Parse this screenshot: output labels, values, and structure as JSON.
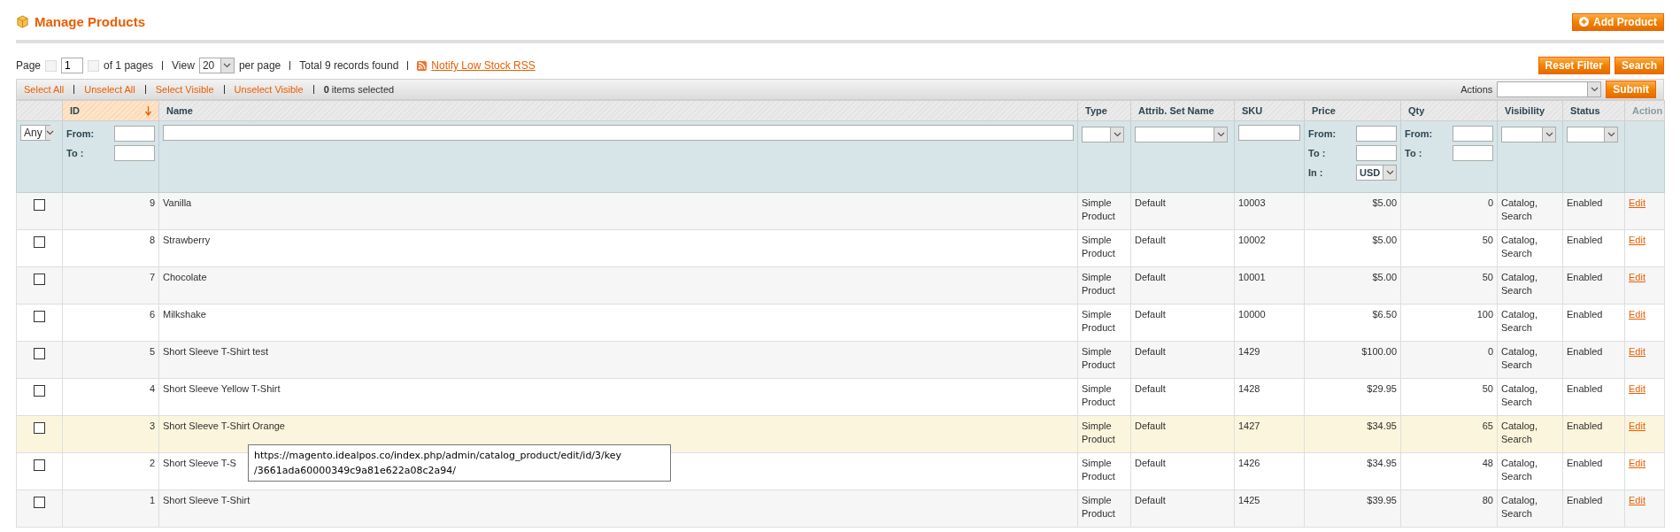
{
  "header": {
    "title": "Manage Products",
    "add_button": "Add Product"
  },
  "pager": {
    "page_label": "Page",
    "page_value": "1",
    "of_pages": "of 1 pages",
    "view_label": "View",
    "view_value": "20",
    "per_page": "per page",
    "total": "Total 9 records found",
    "rss_link": "Notify Low Stock RSS"
  },
  "filter_buttons": [
    "Reset Filter",
    "Search"
  ],
  "massaction": {
    "links": [
      "Select All",
      "Unselect All",
      "Select Visible",
      "Unselect Visible"
    ],
    "count": "0",
    "count_suffix": "items selected",
    "actions_label": "Actions",
    "submit": "Submit"
  },
  "columns": [
    {
      "kind": "checkbox",
      "sorted": false,
      "filter": {
        "kind": "select",
        "value": "Any"
      }
    },
    {
      "kind": "sortable",
      "label": "ID",
      "sorted": true,
      "filter": {
        "kind": "range",
        "from_label": "From:",
        "to_label": "To :"
      }
    },
    {
      "kind": "sortable",
      "label": "Name",
      "sorted": false,
      "filter": {
        "kind": "text"
      }
    },
    {
      "kind": "sortable",
      "label": "Type",
      "sorted": false,
      "filter": {
        "kind": "select"
      }
    },
    {
      "kind": "sortable",
      "label": "Attrib. Set Name",
      "sorted": false,
      "filter": {
        "kind": "select"
      }
    },
    {
      "kind": "sortable",
      "label": "SKU",
      "sorted": false,
      "filter": {
        "kind": "text"
      }
    },
    {
      "kind": "sortable",
      "label": "Price",
      "sorted": false,
      "filter": {
        "kind": "range",
        "from_label": "From:",
        "to_label": "To :",
        "currency_label": "In :",
        "currency_value": "USD"
      }
    },
    {
      "kind": "sortable",
      "label": "Qty",
      "sorted": false,
      "filter": {
        "kind": "range",
        "from_label": "From:",
        "to_label": "To :"
      }
    },
    {
      "kind": "sortable",
      "label": "Visibility",
      "sorted": false,
      "filter": {
        "kind": "select"
      }
    },
    {
      "kind": "sortable",
      "label": "Status",
      "sorted": false,
      "filter": {
        "kind": "select"
      }
    },
    {
      "kind": "static",
      "label": "Action",
      "sorted": false,
      "filter": {
        "kind": "none"
      }
    }
  ],
  "rows": [
    {
      "checked": false,
      "highlighted": false,
      "id": "9",
      "name": "Vanilla",
      "type": "Simple Product",
      "attribute_set": "Default",
      "sku": "10003",
      "price": "$5.00",
      "qty": "0",
      "visibility": "Catalog, Search",
      "status": "Enabled",
      "action": "Edit"
    },
    {
      "checked": false,
      "highlighted": false,
      "id": "8",
      "name": "Strawberry",
      "type": "Simple Product",
      "attribute_set": "Default",
      "sku": "10002",
      "price": "$5.00",
      "qty": "50",
      "visibility": "Catalog, Search",
      "status": "Enabled",
      "action": "Edit"
    },
    {
      "checked": false,
      "highlighted": false,
      "id": "7",
      "name": "Chocolate",
      "type": "Simple Product",
      "attribute_set": "Default",
      "sku": "10001",
      "price": "$5.00",
      "qty": "50",
      "visibility": "Catalog, Search",
      "status": "Enabled",
      "action": "Edit"
    },
    {
      "checked": false,
      "highlighted": false,
      "id": "6",
      "name": "Milkshake",
      "type": "Simple Product",
      "attribute_set": "Default",
      "sku": "10000",
      "price": "$6.50",
      "qty": "100",
      "visibility": "Catalog, Search",
      "status": "Enabled",
      "action": "Edit"
    },
    {
      "checked": false,
      "highlighted": false,
      "id": "5",
      "name": "Short Sleeve T-Shirt test",
      "type": "Simple Product",
      "attribute_set": "Default",
      "sku": "1429",
      "price": "$100.00",
      "qty": "0",
      "visibility": "Catalog, Search",
      "status": "Enabled",
      "action": "Edit"
    },
    {
      "checked": false,
      "highlighted": false,
      "id": "4",
      "name": "Short Sleeve Yellow T-Shirt",
      "type": "Simple Product",
      "attribute_set": "Default",
      "sku": "1428",
      "price": "$29.95",
      "qty": "50",
      "visibility": "Catalog, Search",
      "status": "Enabled",
      "action": "Edit"
    },
    {
      "checked": false,
      "highlighted": true,
      "id": "3",
      "name": "Short Sleeve T-Shirt Orange",
      "type": "Simple Product",
      "attribute_set": "Default",
      "sku": "1427",
      "price": "$34.95",
      "qty": "65",
      "visibility": "Catalog, Search",
      "status": "Enabled",
      "action": "Edit"
    },
    {
      "checked": false,
      "highlighted": false,
      "id": "2",
      "name": "Short Sleeve T-S",
      "type": "Simple Product",
      "attribute_set": "Default",
      "sku": "1426",
      "price": "$34.95",
      "qty": "48",
      "visibility": "Catalog, Search",
      "status": "Enabled",
      "action": "Edit"
    },
    {
      "checked": false,
      "highlighted": false,
      "id": "1",
      "name": "Short Sleeve T-Shirt",
      "type": "Simple Product",
      "attribute_set": "Default",
      "sku": "1425",
      "price": "$39.95",
      "qty": "80",
      "visibility": "Catalog, Search",
      "status": "Enabled",
      "action": "Edit"
    }
  ],
  "tooltip": {
    "lines": [
      "https://magento.idealpos.co/index.php/admin/catalog_product/edit/id/3/key",
      "/3661ada60000349c9a81e622a08c2a94/"
    ]
  }
}
